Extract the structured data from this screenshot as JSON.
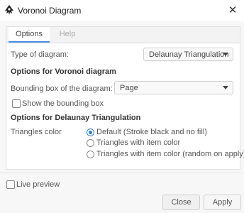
{
  "window": {
    "title": "Voronoi Diagram",
    "close_glyph": "✕"
  },
  "tabs": {
    "options": "Options",
    "help": "Help"
  },
  "type_of_diagram": {
    "label": "Type of diagram:",
    "value": "Delaunay Triangulation"
  },
  "voronoi": {
    "heading": "Options for Voronoi diagram",
    "bbox_label": "Bounding box of the diagram:",
    "bbox_value": "Page",
    "show_bbox_label": "Show the bounding box",
    "show_bbox_checked": false
  },
  "delaunay": {
    "heading": "Options for Delaunay Triangulation",
    "triangles_color_label": "Triangles color",
    "options": [
      {
        "label": "Default (Stroke black and no fill)",
        "selected": true
      },
      {
        "label": "Triangles with item color",
        "selected": false
      },
      {
        "label": "Triangles with item color (random on apply)",
        "selected": false
      }
    ]
  },
  "live_preview": {
    "label": "Live preview",
    "checked": false
  },
  "buttons": {
    "close": "Close",
    "apply": "Apply"
  },
  "colors": {
    "accent": "#2b7fd3",
    "tab_underline": "#4a90e2"
  }
}
